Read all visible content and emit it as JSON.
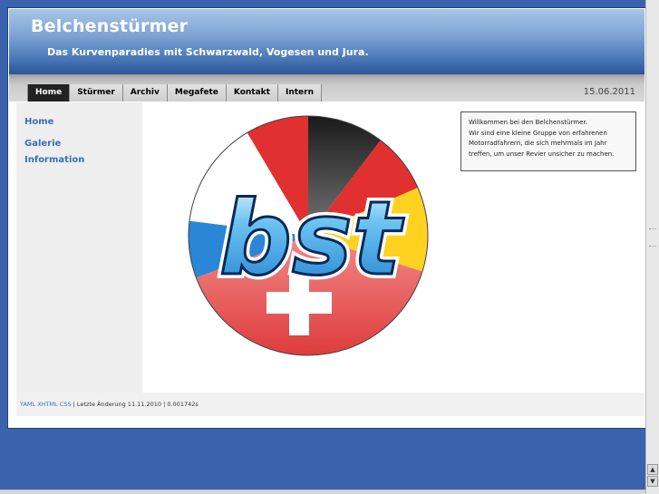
{
  "header": {
    "title": "Belchenstürmer",
    "tagline": "Das Kurvenparadies mit Schwarzwald, Vogesen und Jura."
  },
  "nav": {
    "items": [
      "Home",
      "Stürmer",
      "Archiv",
      "Megafete",
      "Kontakt",
      "Intern"
    ],
    "active": "Home",
    "date": "15.06.2011"
  },
  "sidebar": {
    "items": [
      "Home",
      "Galerie",
      "Information"
    ]
  },
  "welcome": {
    "lines": [
      "Willkommen bei den Belchenstürmer.",
      "Wir sind eine kleine Gruppe von erfahrenen",
      "Motorradfahrern, die sich mehrmals im Jahr",
      "treffen, um unser Revier unsicher zu machen."
    ]
  },
  "logo": {
    "text": "bst"
  },
  "footer": {
    "links": "YAML XHTML CSS",
    "updated": " | Letzte Änderung 11.11.2010 | 0.001742s"
  },
  "colors": {
    "background": "#3a62ad",
    "header_gradient_end": "#2b5697",
    "link": "#3a6fb5",
    "logo_red": "#e03030",
    "logo_yellow": "#ffd21f",
    "logo_black": "#1a1a1a",
    "logo_blue": "#2a86d6"
  }
}
